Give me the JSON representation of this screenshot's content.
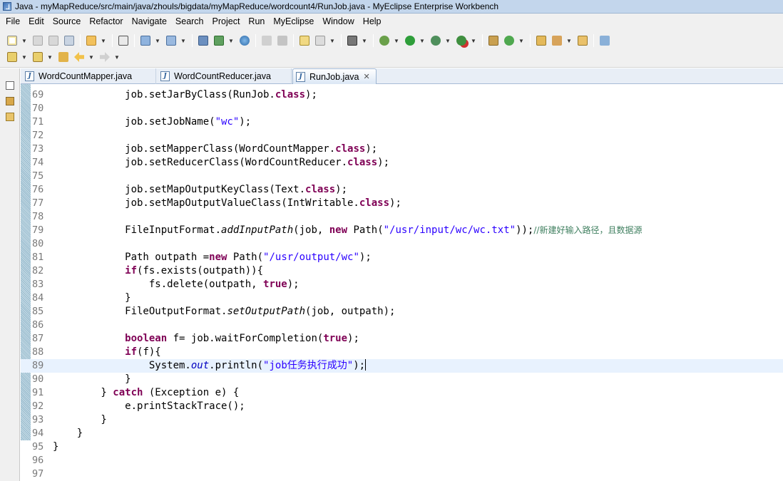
{
  "window": {
    "title": "Java - myMapReduce/src/main/java/zhouls/bigdata/myMapReduce/wordcount4/RunJob.java - MyEclipse Enterprise Workbench"
  },
  "menu": [
    "File",
    "Edit",
    "Source",
    "Refactor",
    "Navigate",
    "Search",
    "Project",
    "Run",
    "MyEclipse",
    "Window",
    "Help"
  ],
  "tabs": [
    {
      "label": "WordCountMapper.java",
      "active": false
    },
    {
      "label": "WordCountReducer.java",
      "active": false
    },
    {
      "label": "RunJob.java",
      "active": true
    }
  ],
  "tab_close_glyph": "✕",
  "editor": {
    "current_line": 89,
    "lines": [
      {
        "n": "69",
        "t": [
          [
            "            job.setJarByClass(RunJob.",
            ""
          ],
          [
            "class",
            "kw"
          ],
          [
            ");",
            ""
          ]
        ]
      },
      {
        "n": "70",
        "t": []
      },
      {
        "n": "71",
        "t": [
          [
            "            job.setJobName(",
            ""
          ],
          [
            "\"wc\"",
            "str"
          ],
          [
            ");",
            ""
          ]
        ]
      },
      {
        "n": "72",
        "t": []
      },
      {
        "n": "73",
        "t": [
          [
            "            job.setMapperClass(WordCountMapper.",
            ""
          ],
          [
            "class",
            "kw"
          ],
          [
            ");",
            ""
          ]
        ]
      },
      {
        "n": "74",
        "t": [
          [
            "            job.setReducerClass(WordCountReducer.",
            ""
          ],
          [
            "class",
            "kw"
          ],
          [
            ");",
            ""
          ]
        ]
      },
      {
        "n": "75",
        "t": []
      },
      {
        "n": "76",
        "t": [
          [
            "            job.setMapOutputKeyClass(Text.",
            ""
          ],
          [
            "class",
            "kw"
          ],
          [
            ");",
            ""
          ]
        ]
      },
      {
        "n": "77",
        "t": [
          [
            "            job.setMapOutputValueClass(IntWritable.",
            ""
          ],
          [
            "class",
            "kw"
          ],
          [
            ");",
            ""
          ]
        ]
      },
      {
        "n": "78",
        "t": []
      },
      {
        "n": "79",
        "t": [
          [
            "            FileInputFormat.",
            ""
          ],
          [
            "addInputPath",
            "it"
          ],
          [
            "(job, ",
            ""
          ],
          [
            "new",
            "kw"
          ],
          [
            " Path(",
            ""
          ],
          [
            "\"/usr/input/wc/wc.txt\"",
            "str"
          ],
          [
            "));",
            ""
          ],
          [
            "//新建好输入路径，且数据源",
            "cmt"
          ]
        ]
      },
      {
        "n": "80",
        "t": []
      },
      {
        "n": "81",
        "t": [
          [
            "            Path outpath =",
            ""
          ],
          [
            "new",
            "kw"
          ],
          [
            " Path(",
            ""
          ],
          [
            "\"/usr/output/wc\"",
            "str"
          ],
          [
            ");",
            ""
          ]
        ]
      },
      {
        "n": "82",
        "t": [
          [
            "            ",
            ""
          ],
          [
            "if",
            "kw"
          ],
          [
            "(fs.exists(outpath)){",
            ""
          ]
        ]
      },
      {
        "n": "83",
        "t": [
          [
            "                fs.delete(outpath, ",
            ""
          ],
          [
            "true",
            "kw"
          ],
          [
            ");",
            ""
          ]
        ]
      },
      {
        "n": "84",
        "t": [
          [
            "            }",
            ""
          ]
        ]
      },
      {
        "n": "85",
        "t": [
          [
            "            FileOutputFormat.",
            ""
          ],
          [
            "setOutputPath",
            "it"
          ],
          [
            "(job, outpath);",
            ""
          ]
        ]
      },
      {
        "n": "86",
        "t": []
      },
      {
        "n": "87",
        "t": [
          [
            "            ",
            ""
          ],
          [
            "boolean",
            "kw"
          ],
          [
            " f= job.waitForCompletion(",
            ""
          ],
          [
            "true",
            "kw"
          ],
          [
            ");",
            ""
          ]
        ]
      },
      {
        "n": "88",
        "t": [
          [
            "            ",
            ""
          ],
          [
            "if",
            "kw"
          ],
          [
            "(f){",
            ""
          ]
        ]
      },
      {
        "n": "89",
        "t": [
          [
            "                System.",
            ""
          ],
          [
            "out",
            "fld"
          ],
          [
            ".println(",
            ""
          ],
          [
            "\"job任务执行成功\"",
            "str"
          ],
          [
            ");",
            ""
          ]
        ]
      },
      {
        "n": "90",
        "t": [
          [
            "            }",
            ""
          ]
        ]
      },
      {
        "n": "91",
        "t": [
          [
            "        } ",
            ""
          ],
          [
            "catch",
            "kw"
          ],
          [
            " (Exception e) {",
            ""
          ]
        ]
      },
      {
        "n": "92",
        "t": [
          [
            "            e.printStackTrace();",
            ""
          ]
        ]
      },
      {
        "n": "93",
        "t": [
          [
            "        }",
            ""
          ]
        ]
      },
      {
        "n": "94",
        "t": [
          [
            "    }",
            ""
          ]
        ]
      },
      {
        "n": "95",
        "t": [
          [
            "}",
            ""
          ]
        ]
      },
      {
        "n": "96",
        "t": []
      },
      {
        "n": "97",
        "t": []
      }
    ]
  }
}
